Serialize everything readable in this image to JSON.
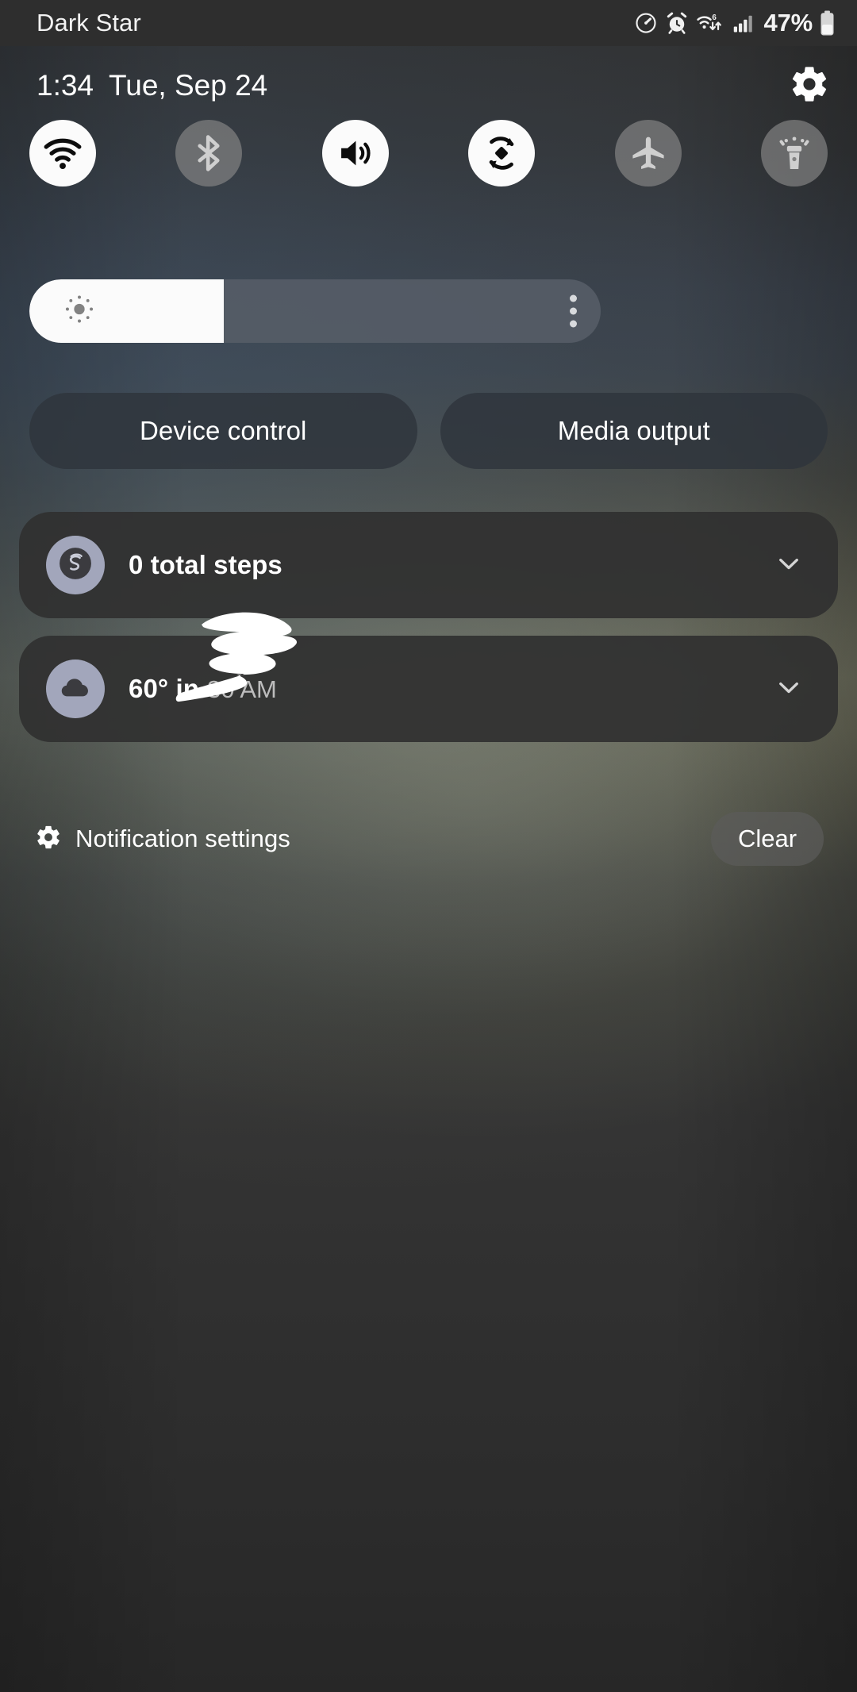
{
  "status_bar": {
    "carrier": "Dark Star",
    "battery_percent": "47%",
    "battery_level": 47,
    "icons": [
      {
        "name": "data-usage-speedometer-icon",
        "label": "Data usage"
      },
      {
        "name": "alarm-clock-icon",
        "label": "Alarm set"
      },
      {
        "name": "wifi-6-transfer-icon",
        "label": "Wi-Fi 6 connected"
      },
      {
        "name": "cellular-signal-icon",
        "label": "Mobile signal"
      }
    ]
  },
  "header": {
    "time": "1:34",
    "date": "Tue, Sep 24",
    "settings_label": "Settings"
  },
  "quick_toggles": [
    {
      "name": "wifi",
      "label": "Wi-Fi",
      "state": "on"
    },
    {
      "name": "bluetooth",
      "label": "Bluetooth",
      "state": "off"
    },
    {
      "name": "sound",
      "label": "Sound",
      "state": "on"
    },
    {
      "name": "auto-rotate",
      "label": "Auto rotate",
      "state": "on"
    },
    {
      "name": "airplane",
      "label": "Airplane mode",
      "state": "off"
    },
    {
      "name": "flashlight",
      "label": "Flashlight",
      "state": "off"
    }
  ],
  "brightness": {
    "label": "Brightness",
    "value_percent": 34,
    "more_options_label": "Brightness options"
  },
  "action_pills": [
    {
      "name": "device-control",
      "label": "Device control"
    },
    {
      "name": "media-output",
      "label": "Media output"
    }
  ],
  "notifications": [
    {
      "name": "steps",
      "icon": "samsung-health-icon",
      "title": "0 total steps",
      "subtitle": "",
      "expand_label": "Expand"
    },
    {
      "name": "weather",
      "icon": "cloud-icon",
      "title": "60° in",
      "subtitle": "30 AM",
      "redacted": true,
      "expand_label": "Expand"
    }
  ],
  "footer": {
    "notification_settings_label": "Notification settings",
    "clear_label": "Clear"
  },
  "colors": {
    "toggle_on_bg": "#fbfbfb",
    "toggle_off_bg": "#838383",
    "notif_card_bg": "#303030",
    "pill_bg": "#2e343c",
    "avatar_bg": "#a2a6bb",
    "slider_track": "#565d68",
    "text_primary": "#ffffff",
    "text_secondary": "#bdbdbd"
  }
}
